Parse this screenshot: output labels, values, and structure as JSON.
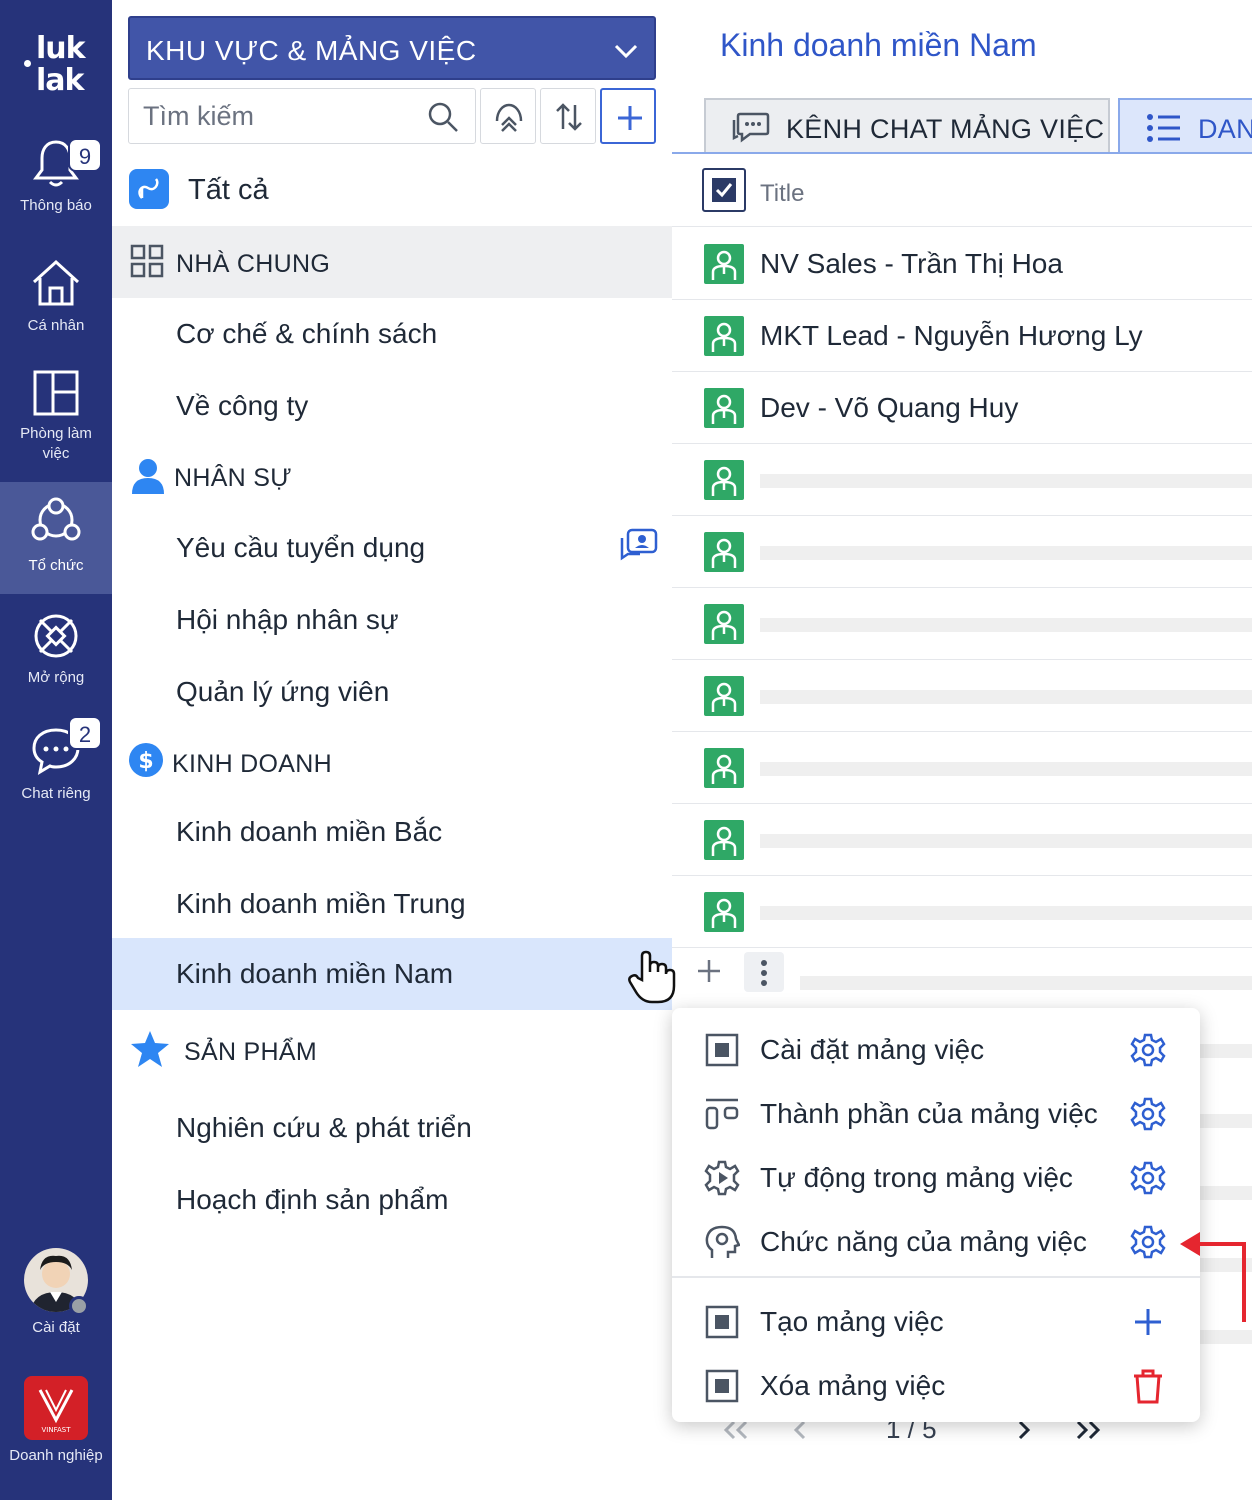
{
  "rail": {
    "logo_line1": "luk",
    "logo_line2": "lak",
    "items": [
      {
        "label": "Thông báo",
        "badge": "9"
      },
      {
        "label": "Cá nhân"
      },
      {
        "label": "Phòng làm việc"
      },
      {
        "label": "Tổ chức",
        "active": true
      },
      {
        "label": "Mở rộng"
      },
      {
        "label": "Chat riêng",
        "badge": "2"
      }
    ],
    "settings_label": "Cài đặt",
    "enterprise_label": "Doanh nghiệp",
    "enterprise_logo_text": "VINFAST"
  },
  "panel": {
    "area_select": "KHU VỰC & MẢNG VIỆC",
    "search_placeholder": "Tìm kiếm",
    "all_label": "Tất cả",
    "sections": [
      {
        "title": "NHÀ CHUNG",
        "items": [
          "Cơ chế & chính sách",
          "Về công ty"
        ]
      },
      {
        "title": "NHÂN SỰ",
        "items": [
          "Yêu cầu tuyển dụng",
          "Hội nhập nhân sự",
          "Quản lý ứng viên"
        ]
      },
      {
        "title": "KINH DOANH",
        "items": [
          "Kinh doanh miền Bắc",
          "Kinh doanh miền Trung",
          "Kinh doanh miền Nam"
        ]
      },
      {
        "title": "SẢN PHẨM",
        "items": [
          "Nghiên cứu & phát triển",
          "Hoạch định sản phẩm"
        ]
      }
    ]
  },
  "content": {
    "title": "Kinh doanh miền Nam",
    "tabs": [
      "KÊNH CHAT MẢNG VIỆC",
      "DAN"
    ],
    "column_title": "Title",
    "rows": [
      "NV Sales - Trần Thị Hoa",
      "MKT Lead - Nguyễn Hương Ly",
      "Dev - Võ Quang Huy"
    ],
    "pager": "1 / 5"
  },
  "context_menu": {
    "items": [
      "Cài đặt mảng việc",
      "Thành phần của mảng việc",
      "Tự động trong mảng việc",
      "Chức năng của mảng việc",
      "Tạo mảng việc",
      "Xóa mảng việc"
    ]
  },
  "colors": {
    "rail_bg": "#26337a",
    "accent": "#2f56c8",
    "select_bg": "#4155a8",
    "avatar_green": "#2fa866",
    "danger": "#e5262f"
  }
}
